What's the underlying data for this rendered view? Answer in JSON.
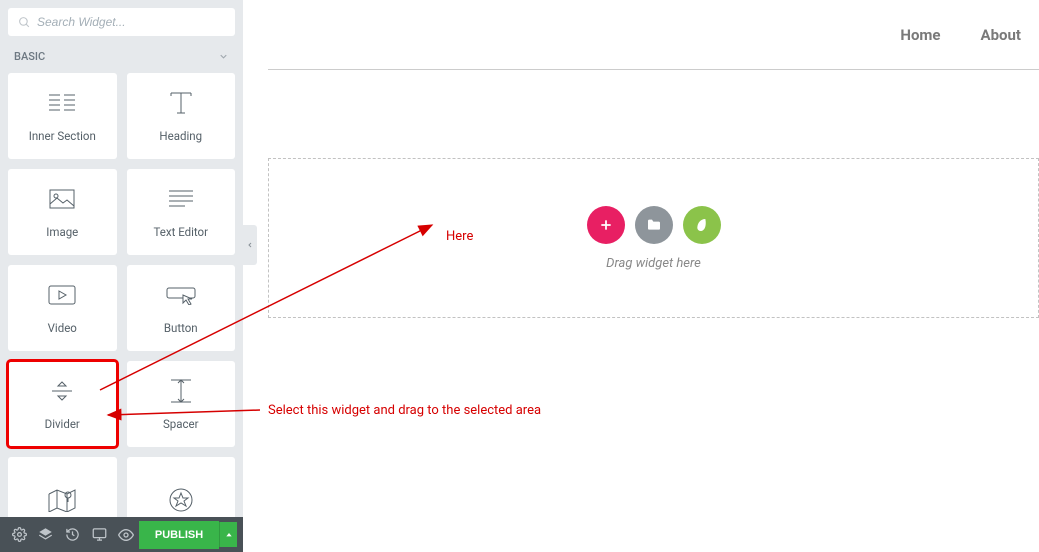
{
  "search": {
    "placeholder": "Search Widget..."
  },
  "category": {
    "label": "BASIC"
  },
  "widgets": [
    {
      "label": "Inner Section"
    },
    {
      "label": "Heading"
    },
    {
      "label": "Image"
    },
    {
      "label": "Text Editor"
    },
    {
      "label": "Video"
    },
    {
      "label": "Button"
    },
    {
      "label": "Divider"
    },
    {
      "label": "Spacer"
    },
    {
      "label": ""
    },
    {
      "label": ""
    }
  ],
  "publish": {
    "label": "PUBLISH"
  },
  "nav": {
    "home": "Home",
    "about": "About"
  },
  "dropzone": {
    "hint": "Drag widget here"
  },
  "annotations": {
    "here": "Here",
    "select": "Select this widget and drag to the selected area"
  }
}
